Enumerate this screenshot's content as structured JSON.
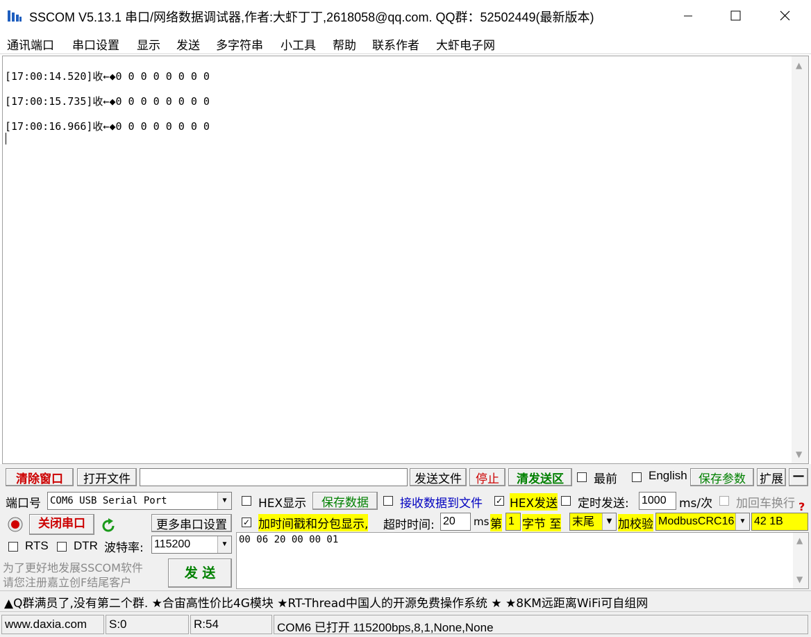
{
  "window": {
    "title": "SSCOM V5.13.1 串口/网络数据调试器,作者:大虾丁丁,2618058@qq.com. QQ群：52502449(最新版本)"
  },
  "menu": [
    "通讯端口",
    "串口设置",
    "显示",
    "发送",
    "多字符串",
    "小工具",
    "帮助",
    "联系作者",
    "大虾电子网"
  ],
  "receive": {
    "lines": [
      "[17:00:14.520]收←◆0 0 0 0 0 0 0 0",
      "[17:00:15.735]收←◆0 0 0 0 0 0 0 0",
      "[17:00:16.966]收←◆0 0 0 0 0 0 0 0"
    ]
  },
  "toolbar": {
    "clear_window": "清除窗口",
    "open_file": "打开文件",
    "file_path": "",
    "send_file": "发送文件",
    "stop": "停止",
    "clear_send": "清发送区",
    "topmost": "最前",
    "english": "English",
    "save_params": "保存参数",
    "expand": "扩展",
    "collapse": "—"
  },
  "port": {
    "port_label": "端口号",
    "port_value": "COM6 USB Serial Port",
    "close_port": "关闭串口",
    "more_settings": "更多串口设置",
    "rts": "RTS",
    "dtr": "DTR",
    "baud_label": "波特率:",
    "baud_value": "115200",
    "promo_line1": "为了更好地发展SSCOM软件",
    "promo_line2": "请您注册嘉立创F结尾客户",
    "send": "发 送"
  },
  "options": {
    "hex_display": "HEX显示",
    "save_data": "保存数据",
    "recv_to_file": "接收数据到文件",
    "hex_send": "HEX发送",
    "timed_send": "定时发送:",
    "interval": "1000",
    "interval_unit": "ms/次",
    "add_crlf": "加回车换行",
    "timestamp": "加时间戳和分包显示,",
    "timeout_label": "超时时间:",
    "timeout_value": "20",
    "timeout_unit": "ms",
    "byte_from_label": "第",
    "byte_from": "1",
    "byte_mid": "字节 至",
    "byte_to": "末尾",
    "checksum_label": "加校验",
    "checksum_type": "ModbusCRC16",
    "checksum_value": "42 1B",
    "help": "?"
  },
  "send_area": {
    "text": "00 06 20 00 00 01"
  },
  "ad": {
    "text": "▲Q群满员了,没有第二个群. ★合宙高性价比4G模块 ★RT-Thread中国人的开源免费操作系统 ★ ★8KM远距离WiFi可自组网"
  },
  "status": {
    "site": "www.daxia.com",
    "sent": "S:0",
    "received": "R:54",
    "port_state": "COM6 已打开  115200bps,8,1,None,None"
  },
  "colors": {
    "highlight": "#ffff00",
    "accent_green": "#008000",
    "accent_red": "#cc0000"
  }
}
